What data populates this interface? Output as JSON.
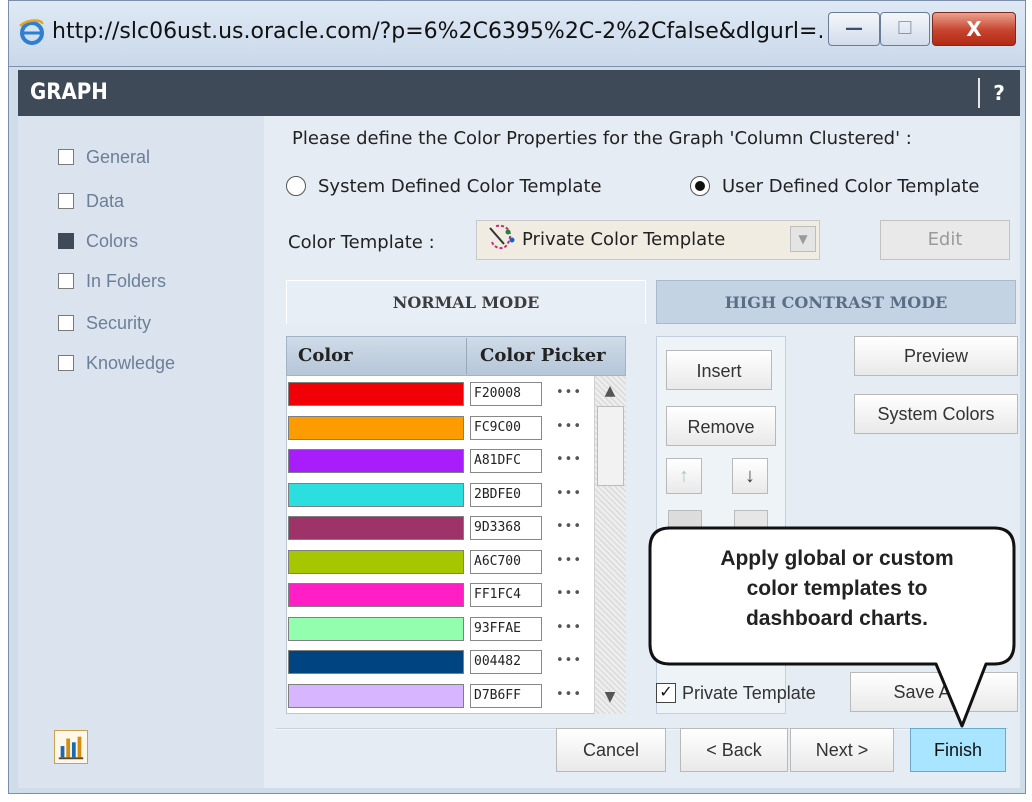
{
  "window": {
    "url": "http://slc06ust.us.oracle.com/?p=6%2C6395%2C-2%2Cfalse&dlgurl=....",
    "min_glyph": "—",
    "max_glyph": "☐",
    "close_glyph": "X"
  },
  "dialog": {
    "title": "GRAPH",
    "help": "?"
  },
  "sidebar": {
    "items": [
      {
        "label": "General",
        "checked": false
      },
      {
        "label": "Data",
        "checked": false
      },
      {
        "label": "Colors",
        "checked": true
      },
      {
        "label": "In Folders",
        "checked": false
      },
      {
        "label": "Security",
        "checked": false
      },
      {
        "label": "Knowledge",
        "checked": false
      }
    ]
  },
  "main": {
    "prompt": "Please define the Color Properties for the Graph 'Column Clustered' :",
    "radio_system": "System Defined Color Template",
    "radio_user": "User Defined Color Template",
    "selected_radio": "user",
    "template_label": "Color Template :",
    "template_value": "Private Color Template",
    "edit_label": "Edit",
    "tab_normal": "NORMAL MODE",
    "tab_high_contrast": "HIGH CONTRAST MODE",
    "col_color": "Color",
    "col_picker": "Color Picker",
    "colors": [
      {
        "hex": "F20008",
        "swatch": "#F20008"
      },
      {
        "hex": "FC9C00",
        "swatch": "#FC9C00"
      },
      {
        "hex": "A81DFC",
        "swatch": "#A81DFC"
      },
      {
        "hex": "2BDFE0",
        "swatch": "#2BDFE0"
      },
      {
        "hex": "9D3368",
        "swatch": "#9D3368"
      },
      {
        "hex": "A6C700",
        "swatch": "#A6C700"
      },
      {
        "hex": "FF1FC4",
        "swatch": "#FF1FC4"
      },
      {
        "hex": "93FFAE",
        "swatch": "#93FFAE"
      },
      {
        "hex": "004482",
        "swatch": "#004482"
      },
      {
        "hex": "D7B6FF",
        "swatch": "#D7B6FF"
      }
    ],
    "picker_dots": "•••",
    "insert_label": "Insert",
    "remove_label": "Remove",
    "move_up_glyph": "↑",
    "move_down_glyph": "↓",
    "preview_label": "Preview",
    "system_colors_label": "System Colors",
    "private_template_label": "Private Template",
    "private_template_checked": true,
    "save_as_label": "Save As...",
    "scroll_up_glyph": "▲",
    "scroll_down_glyph": "▼"
  },
  "footer": {
    "cancel": "Cancel",
    "back": "< Back",
    "next": "Next >",
    "finish": "Finish"
  },
  "callout": {
    "line1": "Apply global or custom",
    "line2": "color templates to",
    "line3": "dashboard charts."
  }
}
